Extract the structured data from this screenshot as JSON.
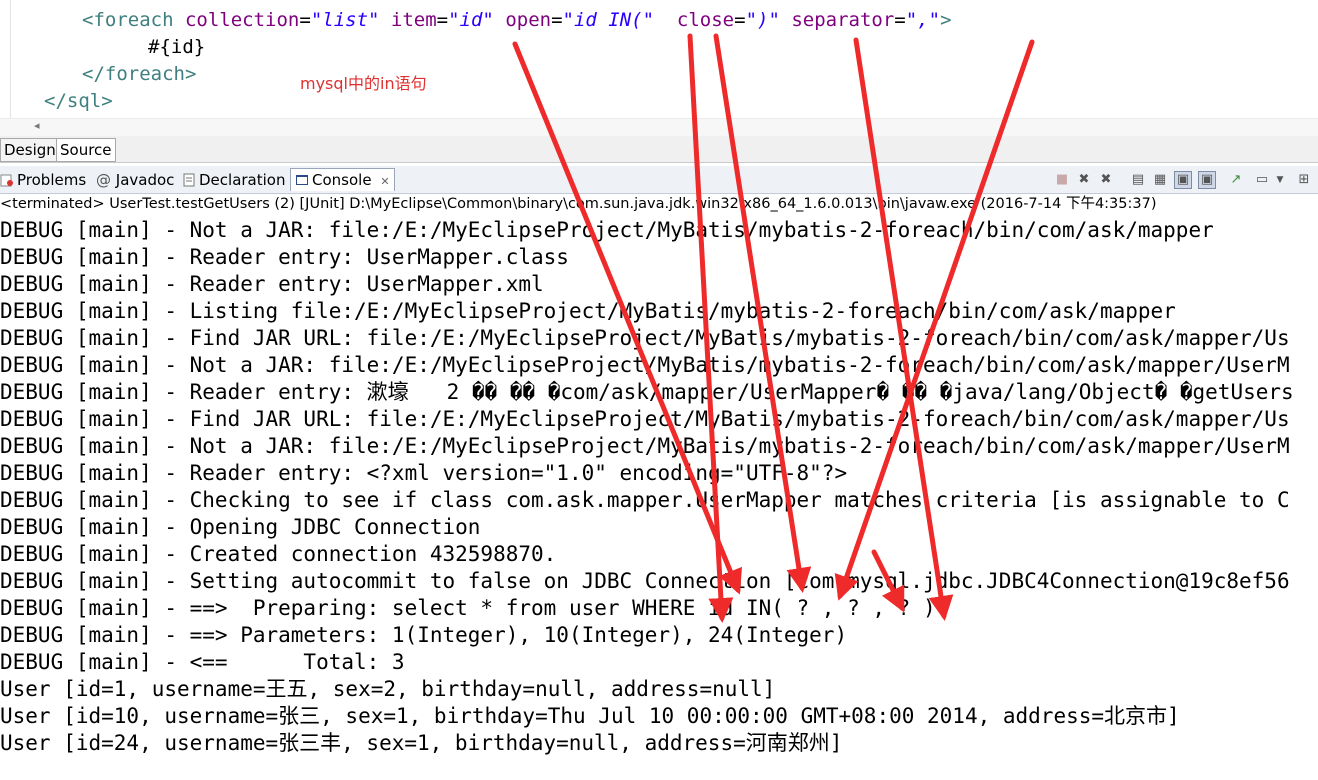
{
  "editor": {
    "line1": {
      "open": "<foreach",
      "attr_collection": " collection",
      "eq1": "=",
      "val_collection": "\"list\"",
      "attr_item": " item",
      "eq2": "=",
      "val_item": "\"id\"",
      "attr_open": " open",
      "eq3": "=",
      "val_open": "\"id IN(\"",
      "attr_close": "  close",
      "eq4": "=",
      "val_close": "\")\"",
      "attr_sep": " separator",
      "eq5": "=",
      "val_sep": "\",\"",
      "end": ">"
    },
    "line2": "#{id}",
    "line3": "</foreach>",
    "line4": "</sql>",
    "annotation": "mysql中的in语句"
  },
  "editor_tabs": {
    "design": "Design",
    "source": "Source"
  },
  "view_tabs": {
    "problems": "Problems",
    "javadoc": "Javadoc",
    "declaration": "Declaration",
    "console": "Console",
    "console_close": "✕"
  },
  "status_line": "<terminated> UserTest.testGetUsers (2) [JUnit] D:\\MyEclipse\\Common\\binary\\com.sun.java.jdk.win32.x86_64_1.6.0.013\\bin\\javaw.exe (2016-7-14 下午4:35:37)",
  "console_lines": [
    "DEBUG [main] - Not a JAR: file:/E:/MyEclipseProject/MyBatis/mybatis-2-foreach/bin/com/ask/mapper",
    "DEBUG [main] - Reader entry: UserMapper.class",
    "DEBUG [main] - Reader entry: UserMapper.xml",
    "DEBUG [main] - Listing file:/E:/MyEclipseProject/MyBatis/mybatis-2-foreach/bin/com/ask/mapper",
    "DEBUG [main] - Find JAR URL: file:/E:/MyEclipseProject/MyBatis/mybatis-2-foreach/bin/com/ask/mapper/Us",
    "DEBUG [main] - Not a JAR: file:/E:/MyEclipseProject/MyBatis/mybatis-2-foreach/bin/com/ask/mapper/UserM",
    "DEBUG [main] - Reader entry: 漱壕   2 �� �� �com/ask/mapper/UserMapper� �� �java/lang/Object� �getUsers",
    "DEBUG [main] - Find JAR URL: file:/E:/MyEclipseProject/MyBatis/mybatis-2-foreach/bin/com/ask/mapper/Us",
    "DEBUG [main] - Not a JAR: file:/E:/MyEclipseProject/MyBatis/mybatis-2-foreach/bin/com/ask/mapper/UserM",
    "DEBUG [main] - Reader entry: <?xml version=\"1.0\" encoding=\"UTF-8\"?>",
    "DEBUG [main] - Checking to see if class com.ask.mapper.UserMapper matches criteria [is assignable to C",
    "DEBUG [main] - Opening JDBC Connection",
    "DEBUG [main] - Created connection 432598870.",
    "DEBUG [main] - Setting autocommit to false on JDBC Connection [com.mysql.jdbc.JDBC4Connection@19c8ef56",
    "DEBUG [main] - ==>  Preparing: select * from user WHERE id IN( ? , ? , ? )",
    "DEBUG [main] - ==> Parameters: 1(Integer), 10(Integer), 24(Integer)",
    "DEBUG [main] - <==      Total: 3",
    "User [id=1, username=王五, sex=2, birthday=null, address=null]",
    "User [id=10, username=张三, sex=1, birthday=Thu Jul 10 00:00:00 GMT+08:00 2014, address=北京市]",
    "User [id=24, username=张三丰, sex=1, birthday=null, address=河南郑州]"
  ],
  "colors": {
    "arrow": "#ee2a2a",
    "tag": "#3f7f7f",
    "attr": "#7f007f",
    "value": "#2a00ff"
  }
}
